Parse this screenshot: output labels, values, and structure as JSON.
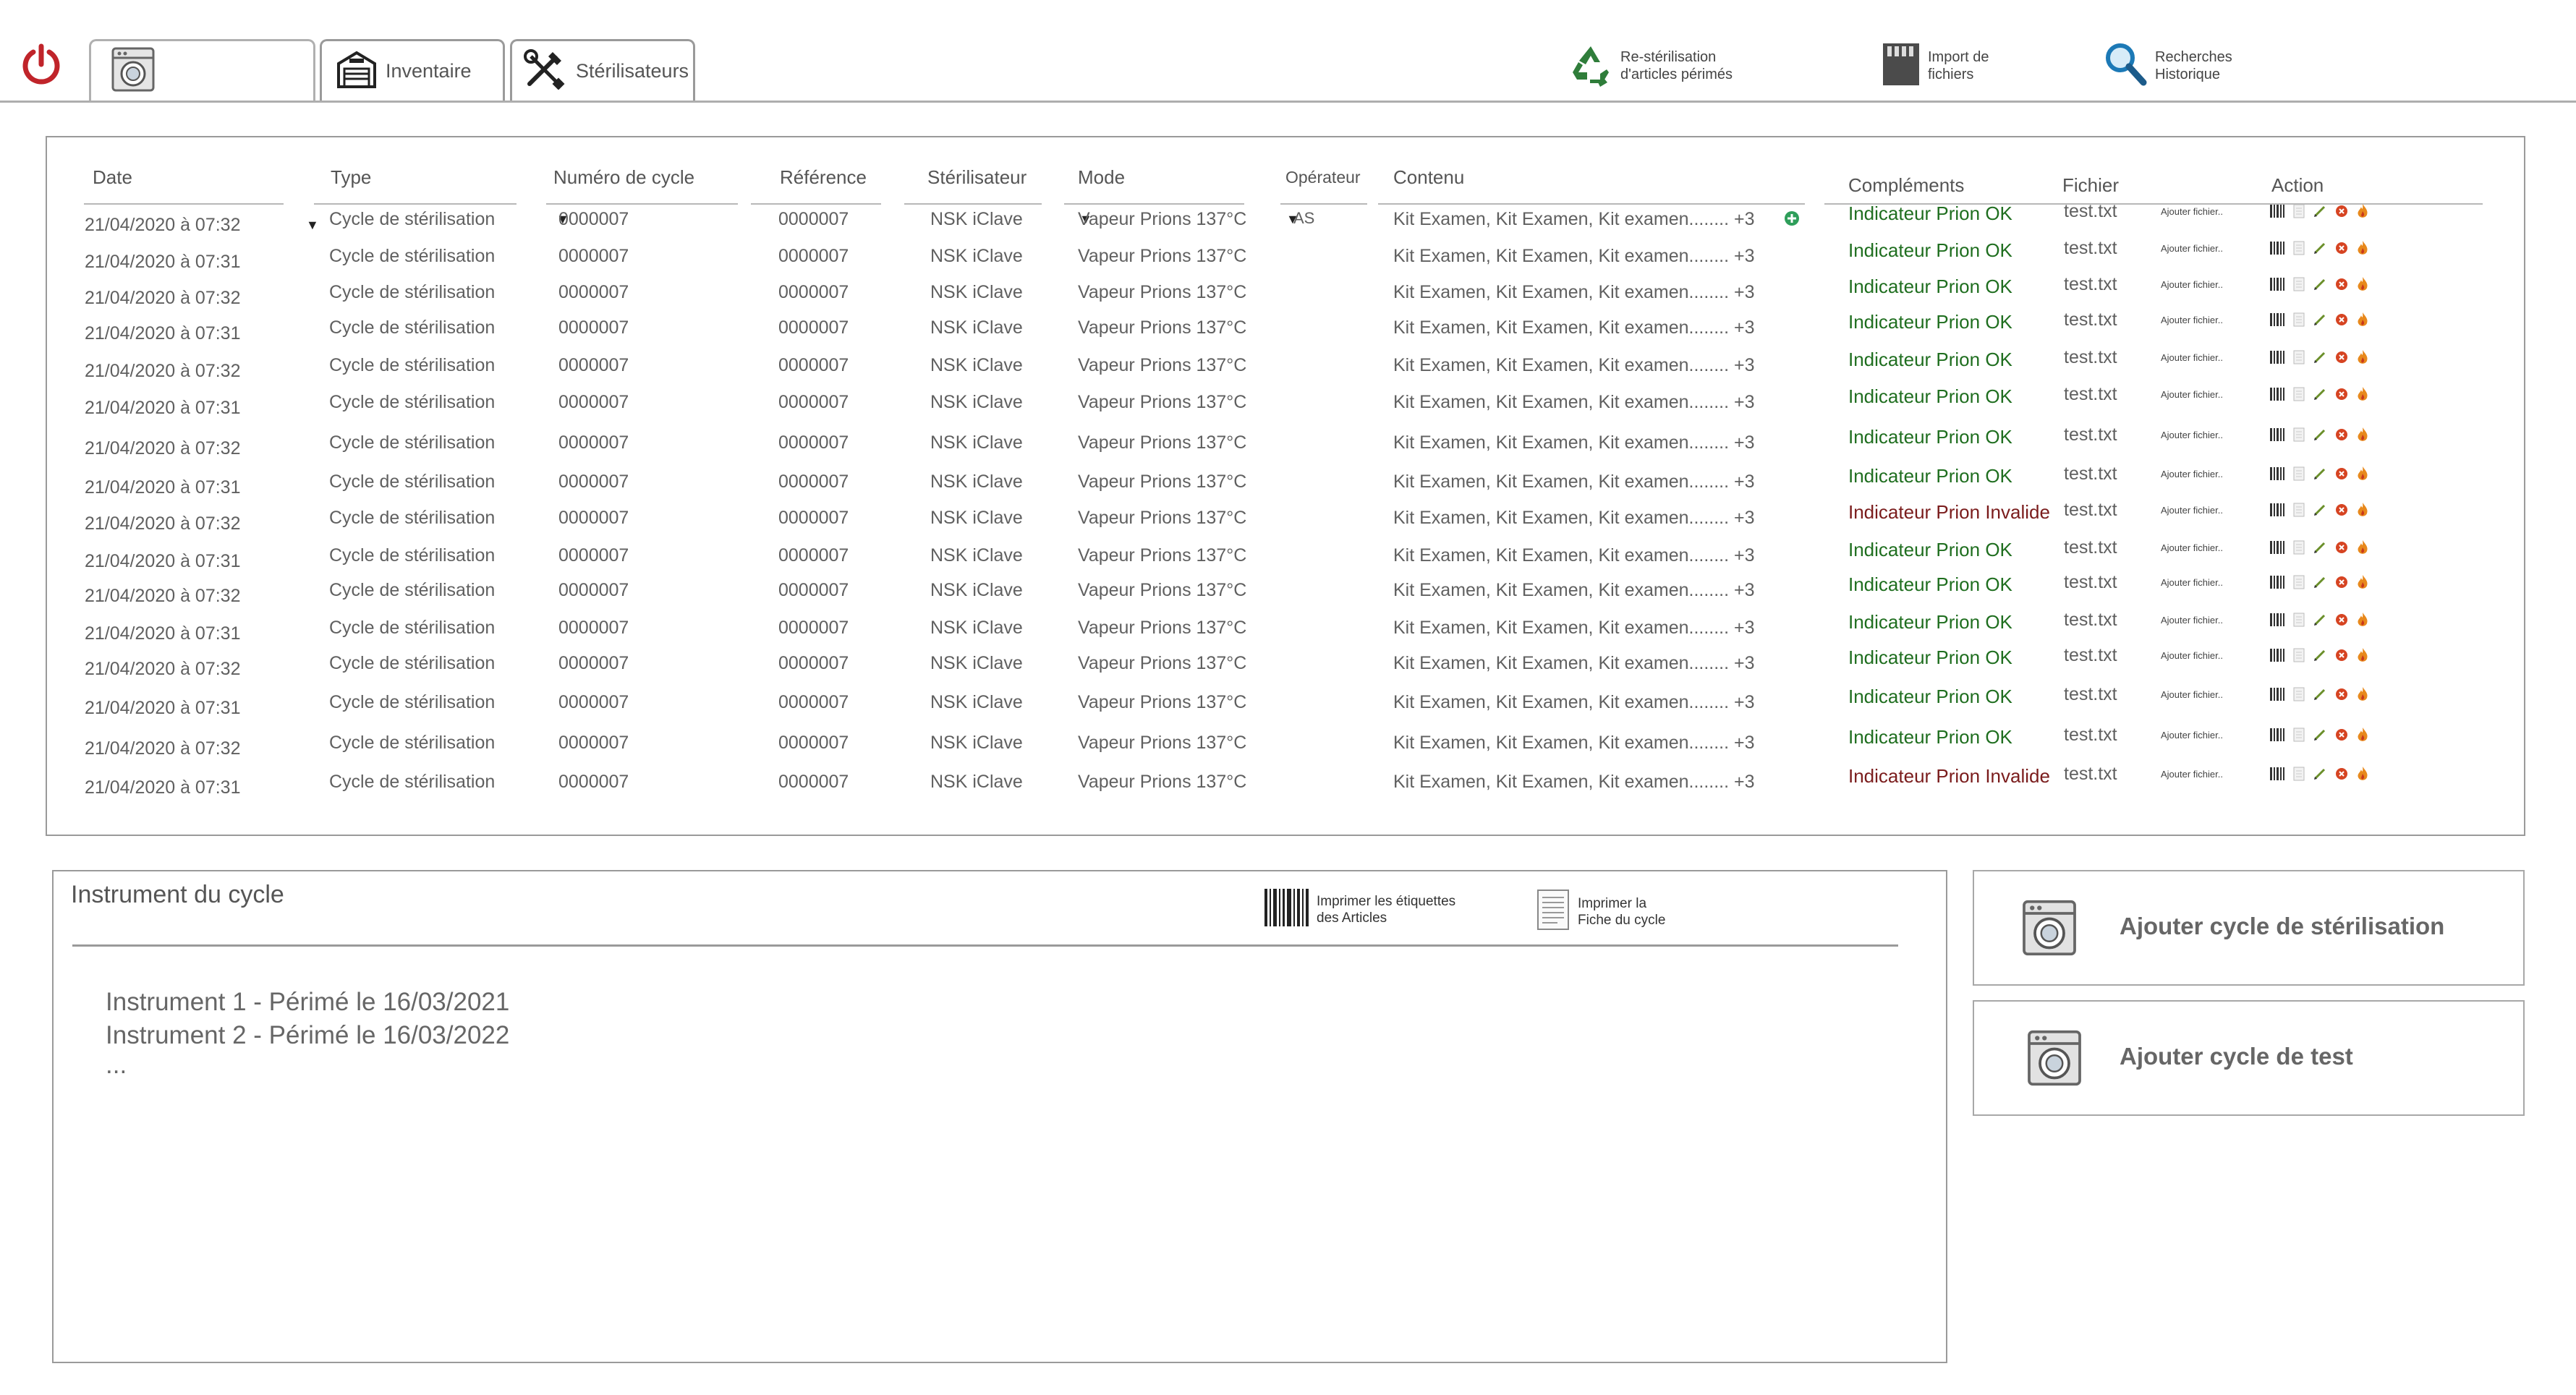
{
  "toolbar": {
    "tabs": [
      {
        "label": ""
      },
      {
        "label": "Inventaire"
      },
      {
        "label": "Stérilisateurs"
      }
    ],
    "actions": [
      {
        "line1": "Re-stérilisation",
        "line2": "d'articles périmés"
      },
      {
        "line1": "Import de",
        "line2": "fichiers"
      },
      {
        "line1": "Recherches",
        "line2": "Historique"
      }
    ]
  },
  "table": {
    "headers": {
      "date": "Date",
      "type": "Type",
      "numero": "Numéro de cycle",
      "reference": "Référence",
      "sterilisateur": "Stérilisateur",
      "mode": "Mode",
      "operateur": "Opérateur",
      "contenu": "Contenu",
      "complements": "Compléments",
      "fichier": "Fichier",
      "action": "Action"
    },
    "rows": [
      {
        "date": "21/04/2020 à 07:32",
        "type": "Cycle de stérilisation",
        "numero": "0000007",
        "reference": "0000007",
        "sterilisateur": "NSK iClave",
        "mode": "Vapeur Prions 137°C",
        "operateur": "AS",
        "contenu": "Kit Examen, Kit Examen, Kit examen........ +3",
        "complement": "Indicateur Prion OK",
        "status": "ok",
        "fichier": "test.txt",
        "ajouter": "Ajouter fichier.."
      },
      {
        "date": "21/04/2020 à 07:31",
        "type": "Cycle de stérilisation",
        "numero": "0000007",
        "reference": "0000007",
        "sterilisateur": "NSK iClave",
        "mode": "Vapeur Prions 137°C",
        "operateur": "",
        "contenu": "Kit Examen, Kit Examen, Kit examen........ +3",
        "complement": "Indicateur Prion OK",
        "status": "ok",
        "fichier": "test.txt",
        "ajouter": "Ajouter fichier.."
      },
      {
        "date": "21/04/2020 à 07:32",
        "type": "Cycle de stérilisation",
        "numero": "0000007",
        "reference": "0000007",
        "sterilisateur": "NSK iClave",
        "mode": "Vapeur Prions 137°C",
        "operateur": "",
        "contenu": "Kit Examen, Kit Examen, Kit examen........ +3",
        "complement": "Indicateur Prion OK",
        "status": "ok",
        "fichier": "test.txt",
        "ajouter": "Ajouter fichier.."
      },
      {
        "date": "21/04/2020 à 07:31",
        "type": "Cycle de stérilisation",
        "numero": "0000007",
        "reference": "0000007",
        "sterilisateur": "NSK iClave",
        "mode": "Vapeur Prions 137°C",
        "operateur": "",
        "contenu": "Kit Examen, Kit Examen, Kit examen........ +3",
        "complement": "Indicateur Prion OK",
        "status": "ok",
        "fichier": "test.txt",
        "ajouter": "Ajouter fichier.."
      },
      {
        "date": "21/04/2020 à 07:32",
        "type": "Cycle de stérilisation",
        "numero": "0000007",
        "reference": "0000007",
        "sterilisateur": "NSK iClave",
        "mode": "Vapeur Prions 137°C",
        "operateur": "",
        "contenu": "Kit Examen, Kit Examen, Kit examen........ +3",
        "complement": "Indicateur Prion OK",
        "status": "ok",
        "fichier": "test.txt",
        "ajouter": "Ajouter fichier.."
      },
      {
        "date": "21/04/2020 à 07:31",
        "type": "Cycle de stérilisation",
        "numero": "0000007",
        "reference": "0000007",
        "sterilisateur": "NSK iClave",
        "mode": "Vapeur Prions 137°C",
        "operateur": "",
        "contenu": "Kit Examen, Kit Examen, Kit examen........ +3",
        "complement": "Indicateur Prion OK",
        "status": "ok",
        "fichier": "test.txt",
        "ajouter": "Ajouter fichier.."
      },
      {
        "date": "21/04/2020 à 07:32",
        "type": "Cycle de stérilisation",
        "numero": "0000007",
        "reference": "0000007",
        "sterilisateur": "NSK iClave",
        "mode": "Vapeur Prions 137°C",
        "operateur": "",
        "contenu": "Kit Examen, Kit Examen, Kit examen........ +3",
        "complement": "Indicateur Prion OK",
        "status": "ok",
        "fichier": "test.txt",
        "ajouter": "Ajouter fichier.."
      },
      {
        "date": "21/04/2020 à 07:31",
        "type": "Cycle de stérilisation",
        "numero": "0000007",
        "reference": "0000007",
        "sterilisateur": "NSK iClave",
        "mode": "Vapeur Prions 137°C",
        "operateur": "",
        "contenu": "Kit Examen, Kit Examen, Kit examen........ +3",
        "complement": "Indicateur Prion OK",
        "status": "ok",
        "fichier": "test.txt",
        "ajouter": "Ajouter fichier.."
      },
      {
        "date": "21/04/2020 à 07:32",
        "type": "Cycle de stérilisation",
        "numero": "0000007",
        "reference": "0000007",
        "sterilisateur": "NSK iClave",
        "mode": "Vapeur Prions 137°C",
        "operateur": "",
        "contenu": "Kit Examen, Kit Examen, Kit examen........ +3",
        "complement": "Indicateur Prion Invalide",
        "status": "invalid",
        "fichier": "test.txt",
        "ajouter": "Ajouter fichier.."
      },
      {
        "date": "21/04/2020 à 07:31",
        "type": "Cycle de stérilisation",
        "numero": "0000007",
        "reference": "0000007",
        "sterilisateur": "NSK iClave",
        "mode": "Vapeur Prions 137°C",
        "operateur": "",
        "contenu": "Kit Examen, Kit Examen, Kit examen........ +3",
        "complement": "Indicateur Prion OK",
        "status": "ok",
        "fichier": "test.txt",
        "ajouter": "Ajouter fichier.."
      },
      {
        "date": "21/04/2020 à 07:32",
        "type": "Cycle de stérilisation",
        "numero": "0000007",
        "reference": "0000007",
        "sterilisateur": "NSK iClave",
        "mode": "Vapeur Prions 137°C",
        "operateur": "",
        "contenu": "Kit Examen, Kit Examen, Kit examen........ +3",
        "complement": "Indicateur Prion OK",
        "status": "ok",
        "fichier": "test.txt",
        "ajouter": "Ajouter fichier.."
      },
      {
        "date": "21/04/2020 à 07:31",
        "type": "Cycle de stérilisation",
        "numero": "0000007",
        "reference": "0000007",
        "sterilisateur": "NSK iClave",
        "mode": "Vapeur Prions 137°C",
        "operateur": "",
        "contenu": "Kit Examen, Kit Examen, Kit examen........ +3",
        "complement": "Indicateur Prion OK",
        "status": "ok",
        "fichier": "test.txt",
        "ajouter": "Ajouter fichier.."
      },
      {
        "date": "21/04/2020 à 07:32",
        "type": "Cycle de stérilisation",
        "numero": "0000007",
        "reference": "0000007",
        "sterilisateur": "NSK iClave",
        "mode": "Vapeur Prions 137°C",
        "operateur": "",
        "contenu": "Kit Examen, Kit Examen, Kit examen........ +3",
        "complement": "Indicateur Prion OK",
        "status": "ok",
        "fichier": "test.txt",
        "ajouter": "Ajouter fichier.."
      },
      {
        "date": "21/04/2020 à 07:31",
        "type": "Cycle de stérilisation",
        "numero": "0000007",
        "reference": "0000007",
        "sterilisateur": "NSK iClave",
        "mode": "Vapeur Prions 137°C",
        "operateur": "",
        "contenu": "Kit Examen, Kit Examen, Kit examen........ +3",
        "complement": "Indicateur Prion OK",
        "status": "ok",
        "fichier": "test.txt",
        "ajouter": "Ajouter fichier.."
      },
      {
        "date": "21/04/2020 à 07:32",
        "type": "Cycle de stérilisation",
        "numero": "0000007",
        "reference": "0000007",
        "sterilisateur": "NSK iClave",
        "mode": "Vapeur Prions 137°C",
        "operateur": "",
        "contenu": "Kit Examen, Kit Examen, Kit examen........ +3",
        "complement": "Indicateur Prion OK",
        "status": "ok",
        "fichier": "test.txt",
        "ajouter": "Ajouter fichier.."
      },
      {
        "date": "21/04/2020 à 07:31",
        "type": "Cycle de stérilisation",
        "numero": "0000007",
        "reference": "0000007",
        "sterilisateur": "NSK iClave",
        "mode": "Vapeur Prions 137°C",
        "operateur": "",
        "contenu": "Kit Examen, Kit Examen, Kit examen........ +3",
        "complement": "Indicateur Prion Invalide",
        "status": "invalid",
        "fichier": "test.txt",
        "ajouter": "Ajouter fichier.."
      }
    ]
  },
  "instrument_panel": {
    "title": "Instrument du cycle",
    "print_labels": {
      "line1": "Imprimer les étiquettes",
      "line2": "des Articles"
    },
    "print_sheet": {
      "line1": "Imprimer la",
      "line2": "Fiche du cycle"
    },
    "items": [
      "Instrument 1 - Périmé le 16/03/2021",
      "Instrument 2 - Périmé le 16/03/2022",
      "..."
    ]
  },
  "buttons": {
    "add_sterilisation": "Ajouter cycle de stérilisation",
    "add_test": "Ajouter cycle de  test"
  },
  "colors": {
    "status_ok": "#1f6e1f",
    "status_invalid": "#7a1c1c",
    "power": "#c0242a",
    "plus": "#2e9e5a"
  },
  "icons": {
    "power": "power-icon",
    "washer": "washer-icon",
    "inventory": "warehouse-icon",
    "sterilizers": "tools-icon",
    "recycle": "recycle-icon",
    "import": "sd-card-icon",
    "search": "magnifier-icon",
    "barcode": "barcode-icon",
    "document": "document-icon"
  }
}
